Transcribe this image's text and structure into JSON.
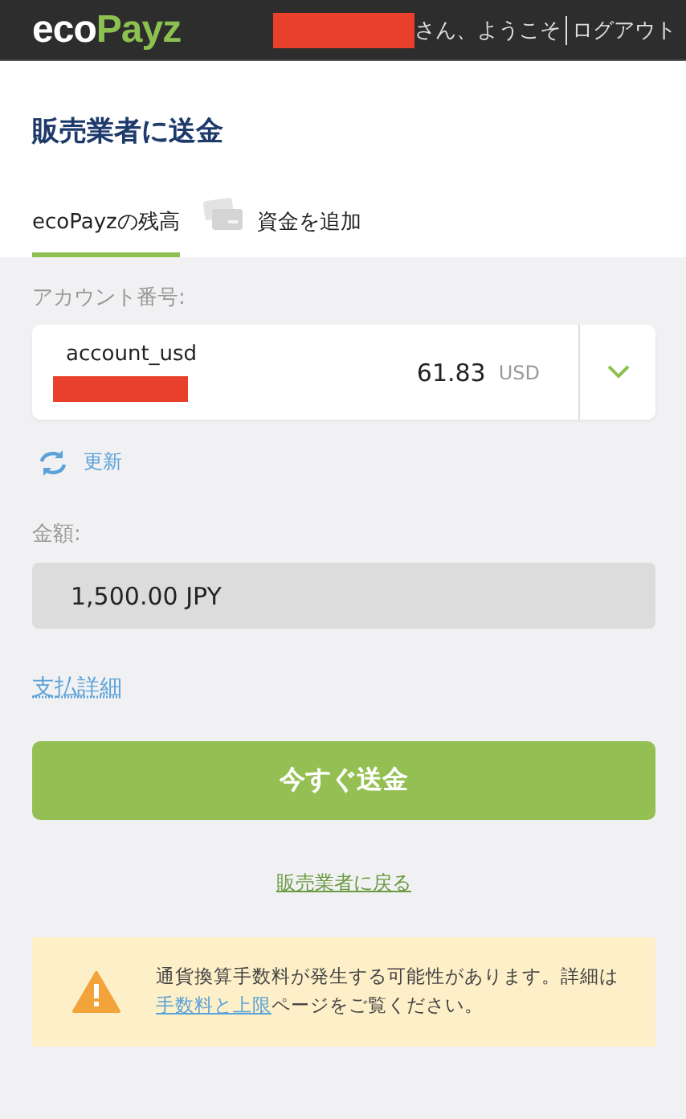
{
  "header": {
    "logo": [
      "eco",
      "Payz"
    ],
    "greeting": "さん、ようこそ",
    "logout": "ログアウト"
  },
  "title": "販売業者に送金",
  "tabs": [
    {
      "label": "ecoPayzの残高",
      "kind": "plain",
      "selected": true
    },
    {
      "label": "資金を追加",
      "kind": "card",
      "selected": false
    }
  ],
  "account": {
    "label": "アカウント番号:",
    "name": "account_usd",
    "balance": "61.83",
    "currency": "USD"
  },
  "refresh": "更新",
  "amount": {
    "label": "金額:",
    "value": "1,500.00 JPY"
  },
  "details_link": "支払詳細",
  "send_button": "今すぐ送金",
  "back_link": "販売業者に戻る",
  "notice": {
    "before": "通貨換算手数料が発生する可能性があります。詳細は",
    "link": "手数料と上限",
    "after": "ページをご覧ください。"
  }
}
